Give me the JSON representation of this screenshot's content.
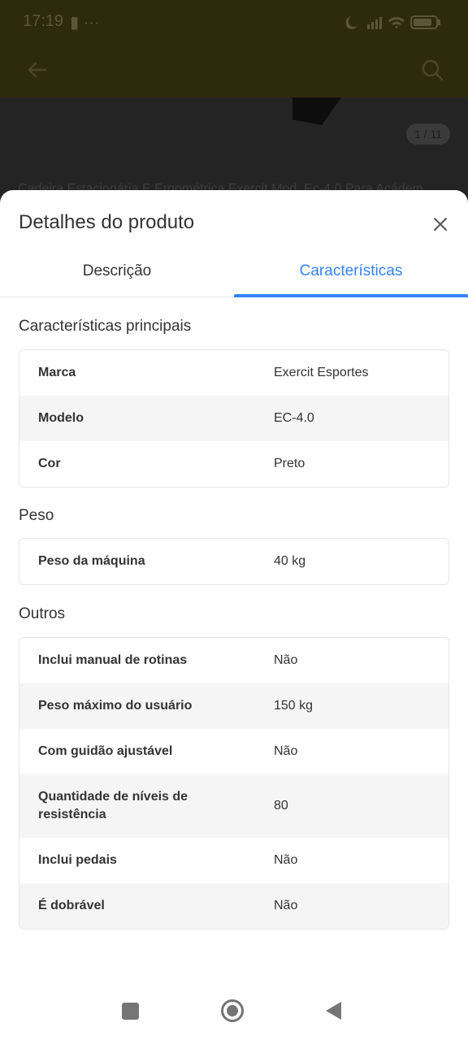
{
  "status_bar": {
    "time": "17:19",
    "extra": "▮ ···",
    "battery": "87"
  },
  "background": {
    "image_counter": "1 / 11",
    "product_title": "Cadeira Estacionária E Ergométrica Exercit Mod. Ec-4.0 Para Acádem..."
  },
  "sheet": {
    "title": "Detalhes do produto",
    "tabs": [
      {
        "label": "Descrição",
        "active": false
      },
      {
        "label": "Características",
        "active": true
      }
    ],
    "sections": [
      {
        "title": "Características principais",
        "rows": [
          {
            "key": "Marca",
            "value": "Exercit Esportes"
          },
          {
            "key": "Modelo",
            "value": "EC-4.0"
          },
          {
            "key": "Cor",
            "value": "Preto"
          }
        ]
      },
      {
        "title": "Peso",
        "rows": [
          {
            "key": "Peso da máquina",
            "value": "40 kg"
          }
        ]
      },
      {
        "title": "Outros",
        "rows": [
          {
            "key": "Inclui manual de rotinas",
            "value": "Não"
          },
          {
            "key": "Peso máximo do usuário",
            "value": "150 kg"
          },
          {
            "key": "Com guidão ajustável",
            "value": "Não"
          },
          {
            "key": "Quantidade de níveis de resistência",
            "value": "80"
          },
          {
            "key": "Inclui pedais",
            "value": "Não"
          },
          {
            "key": "É dobrável",
            "value": "Não"
          }
        ]
      }
    ]
  },
  "colors": {
    "accent": "#3483fa",
    "text": "#333333",
    "row_alt": "#f5f5f5",
    "header_dim": "#2e2a0c"
  },
  "icons": [
    "back-arrow-icon",
    "search-icon",
    "close-icon",
    "recents-icon",
    "home-icon",
    "back-icon"
  ]
}
